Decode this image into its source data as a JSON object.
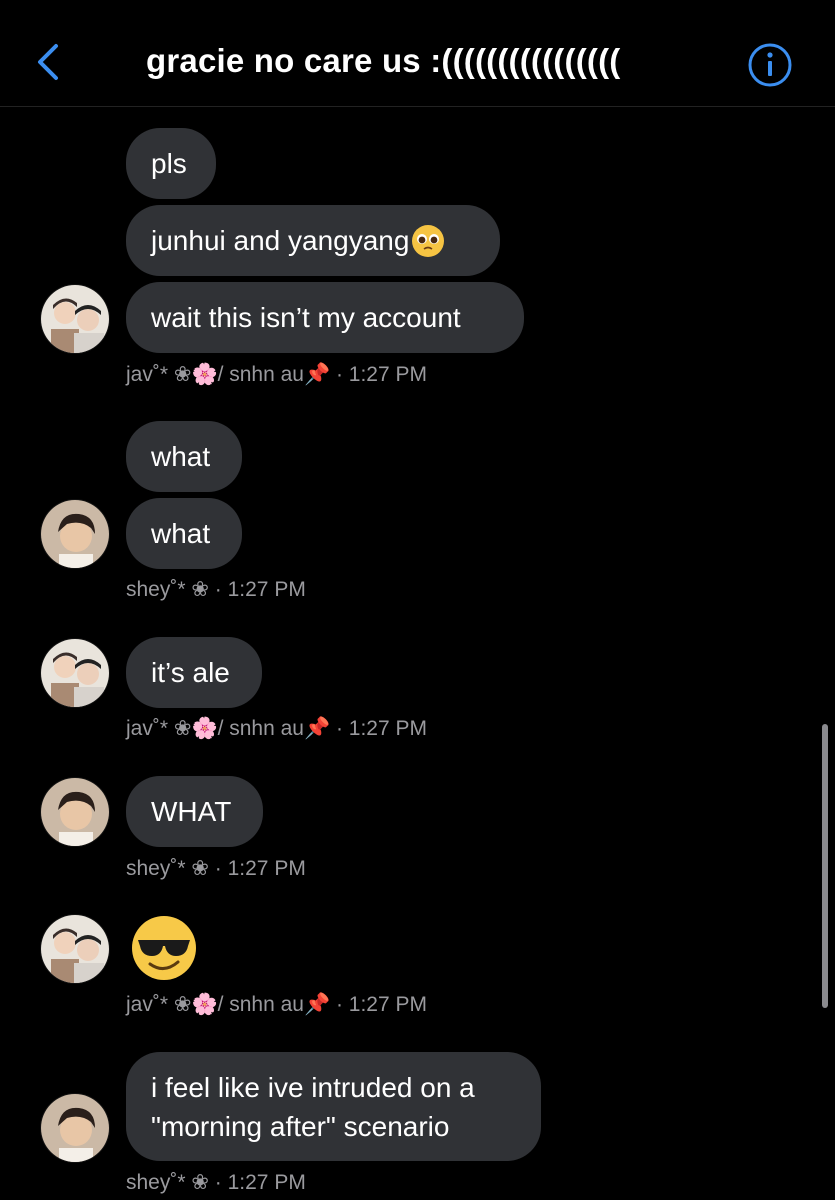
{
  "header": {
    "title": "gracie no care us :((((((((((((((((",
    "back_icon": "chevron-left-icon",
    "info_icon": "info-circle-icon",
    "accent_color": "#3b8ef0"
  },
  "messages": {
    "m1": "pls",
    "m2": "junhui and yangyang",
    "m3": "wait this isn’t my account",
    "m4": "what",
    "m5": "what",
    "m6": "it’s ale",
    "m7": "WHAT",
    "m8_emoji": "smiling-face-with-sunglasses",
    "m9": "i feel like ive intruded on a\n\"morning after\" scenario"
  },
  "meta": {
    "jav1": "jav˚* ❀🌸/ snhn au📌  · 1:27 PM",
    "shey1": "shey˚* ❀  · 1:27 PM",
    "jav2": "jav˚* ❀🌸/ snhn au📌  · 1:27 PM",
    "shey2": "shey˚* ❀  · 1:27 PM",
    "jav3": "jav˚* ❀🌸/ snhn au📌  · 1:27 PM",
    "shey3": "shey˚* ❀  · 1:27 PM"
  },
  "colors": {
    "background": "#000000",
    "bubble": "#303236",
    "meta_text": "#9a9a9e"
  }
}
